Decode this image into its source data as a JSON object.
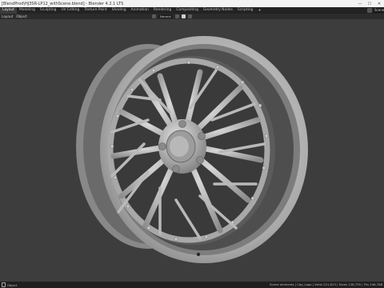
{
  "window": {
    "title": "[BlendProd\\HJ3SR-LP12_withScene.blend] - Blender 4.2.1 LTS",
    "minimize_symbol": "—",
    "maximize_symbol": "☐",
    "close_symbol": "✕"
  },
  "workspaces": [
    "Layout",
    "Modeling",
    "Sculpting",
    "UV Editing",
    "Texture Paint",
    "Shading",
    "Animation",
    "Rendering",
    "Compositing",
    "Geometry Nodes",
    "Scripting"
  ],
  "active_workspace": "Layout",
  "workspace_add": "+",
  "scene": {
    "label": "Scene"
  },
  "menubar": {
    "items": [
      "Layout",
      "Object"
    ],
    "transform_orientation": "Normal"
  },
  "status": {
    "left_label": "Object",
    "right_text": "Scene elements | Cap_Logo | Verts 221,813 | Faces 128,755 | Tris 248,788"
  },
  "colors": {
    "viewport_bg": "#3d3d3d",
    "wheel_base": "#9a9a9a",
    "wheel_light": "#cfcfcf",
    "wheel_dark": "#555555"
  }
}
